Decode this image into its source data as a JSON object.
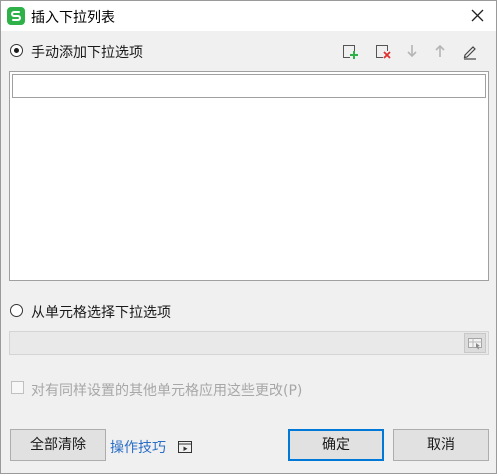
{
  "window": {
    "title": "插入下拉列表",
    "close_icon": "close-icon",
    "app_icon": "wps-spreadsheet-icon"
  },
  "options": {
    "manual": {
      "label": "手动添加下拉选项",
      "selected": true
    },
    "from_cells": {
      "label": "从单元格选择下拉选项",
      "selected": false
    }
  },
  "toolbar": {
    "add_icon": "add-item-icon",
    "delete_icon": "delete-item-icon",
    "move_down_icon": "arrow-down-icon",
    "move_up_icon": "arrow-up-icon",
    "edit_icon": "edit-icon"
  },
  "list": {
    "items": [
      ""
    ]
  },
  "range": {
    "value": "",
    "picker_icon": "range-picker-icon"
  },
  "apply_all": {
    "label": "对有同样设置的其他单元格应用这些更改(P)",
    "checked": false,
    "enabled": false
  },
  "footer": {
    "clear_all": "全部清除",
    "tips_link": "操作技巧",
    "tips_icon": "video-icon",
    "ok": "确定",
    "cancel": "取消"
  },
  "colors": {
    "accent": "#0078d7",
    "link": "#2a6ec6",
    "brand": "#2fb14a",
    "delete": "#e03030"
  }
}
